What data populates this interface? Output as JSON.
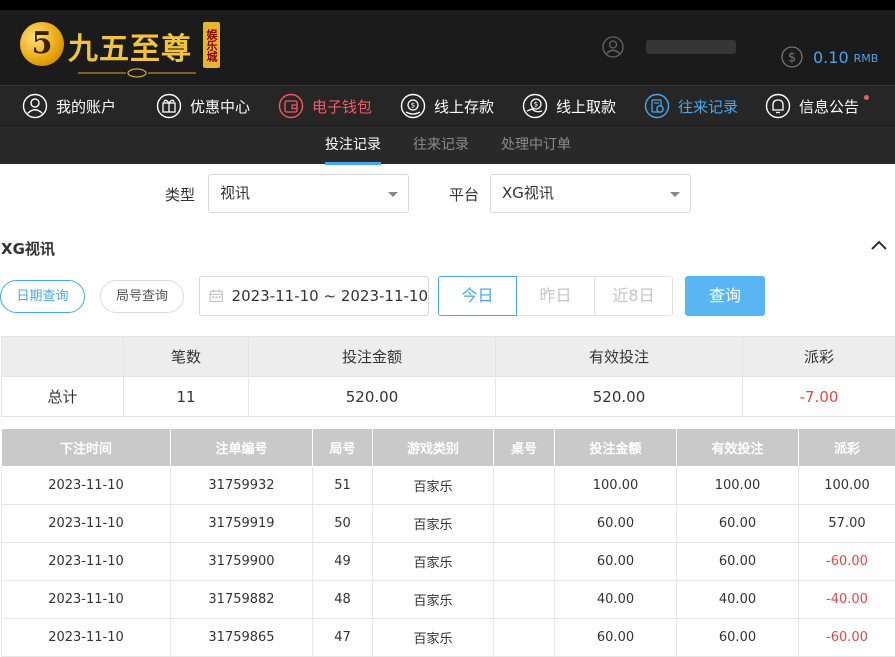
{
  "logo": {
    "emblem": "5",
    "name": "九五至尊",
    "badge": "娱乐城"
  },
  "balance": {
    "amount": "0.10",
    "unit": "RMB"
  },
  "nav": [
    {
      "label": "我的账户",
      "icon": "user-icon"
    },
    {
      "label": "优惠中心",
      "icon": "gift-icon"
    },
    {
      "label": "电子钱包",
      "icon": "wallet-icon"
    },
    {
      "label": "线上存款",
      "icon": "deposit-icon"
    },
    {
      "label": "线上取款",
      "icon": "withdraw-icon"
    },
    {
      "label": "往来记录",
      "icon": "records-icon"
    },
    {
      "label": "信息公告",
      "icon": "bell-icon"
    }
  ],
  "subtabs": [
    "投注记录",
    "往来记录",
    "处理中订单"
  ],
  "filters": {
    "type_label": "类型",
    "type_value": "视讯",
    "platform_label": "平台",
    "platform_value": "XG视讯"
  },
  "section_title": "XG视讯",
  "query": {
    "mode_date": "日期查询",
    "mode_round": "局号查询",
    "date_range": "2023-11-10 ~ 2023-11-10",
    "today": "今日",
    "yesterday": "昨日",
    "last8": "近8日",
    "button": "查询"
  },
  "summary": {
    "headers": [
      "",
      "笔数",
      "投注金额",
      "有效投注",
      "派彩"
    ],
    "row": {
      "label": "总计",
      "count": "11",
      "bet": "520.00",
      "valid": "520.00",
      "payout": "-7.00"
    }
  },
  "detail": {
    "headers": [
      "下注时间",
      "注单编号",
      "局号",
      "游戏类别",
      "桌号",
      "投注金额",
      "有效投注",
      "派彩"
    ],
    "rows": [
      [
        "2023-11-10",
        "31759932",
        "51",
        "百家乐",
        "",
        "100.00",
        "100.00",
        "100.00"
      ],
      [
        "2023-11-10",
        "31759919",
        "50",
        "百家乐",
        "",
        "60.00",
        "60.00",
        "57.00"
      ],
      [
        "2023-11-10",
        "31759900",
        "49",
        "百家乐",
        "",
        "60.00",
        "60.00",
        "-60.00"
      ],
      [
        "2023-11-10",
        "31759882",
        "48",
        "百家乐",
        "",
        "40.00",
        "40.00",
        "-40.00"
      ],
      [
        "2023-11-10",
        "31759865",
        "47",
        "百家乐",
        "",
        "60.00",
        "60.00",
        "-60.00"
      ]
    ]
  },
  "colors": {
    "accent": "#4aa6ee",
    "negative": "#e24a4a",
    "nav_red": "#ef5a66",
    "logo_gold": "#f3c33c"
  }
}
